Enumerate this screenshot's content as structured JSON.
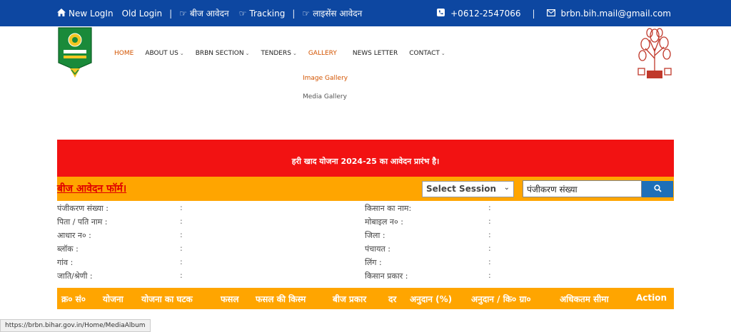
{
  "topbar": {
    "new_login": "New LogIn",
    "old_login": "Old Login",
    "sep": "|",
    "beej_aavedan": "बीज आवेदन",
    "tracking": "Tracking",
    "license_aavedan": "लाइसेंस आवेदन",
    "phone": "+0612-2547066",
    "email": "brbn.bih.mail@gmail.com"
  },
  "nav": {
    "home": "HOME",
    "about": "ABOUT US",
    "brbn": "BRBN SECTION",
    "tenders": "TENDERS",
    "gallery": "GALLERY",
    "newsletter": "NEWS LETTER",
    "contact": "CONTACT",
    "submenu": [
      "Image Gallery",
      "Media Gallery"
    ]
  },
  "banner": {
    "text": "हरी खाद योजना 2024-25 का आवेदन प्रारंभ है।"
  },
  "form": {
    "title": "बीज आवेदन फॉर्म।",
    "session_selected": "Select Session",
    "reg_value": "पंजीकरण संख्या"
  },
  "info": {
    "colon": ":",
    "left": [
      "पंजीकरण संख्या :",
      "पिता / पति नाम :",
      "आधार न० :",
      "ब्लॉक :",
      "गांव :",
      "जाति/श्रेणी :"
    ],
    "right": [
      "किसान का नाम:",
      "मोबाइल न० :",
      "जिला :",
      "पंचायत :",
      "लिंग :",
      "किसान प्रकार :"
    ]
  },
  "table": {
    "headers": [
      "क्र० सं०",
      "योजना",
      "योजना का घटक",
      "फसल",
      "फसल की किस्म",
      "बीज प्रकार",
      "दर",
      "अनुदान (%)",
      "अनुदान / कि० ग्रा०",
      "अधिकतम सीमा",
      "Action"
    ]
  },
  "status_url": "https://brbn.bihar.gov.in/Home/MediaAlbum",
  "colors": {
    "topbar": "#0d47a1",
    "banner": "#f21212",
    "orange": "#ffa500",
    "link_red": "#e00000",
    "search_btn": "#1e6fb8"
  }
}
